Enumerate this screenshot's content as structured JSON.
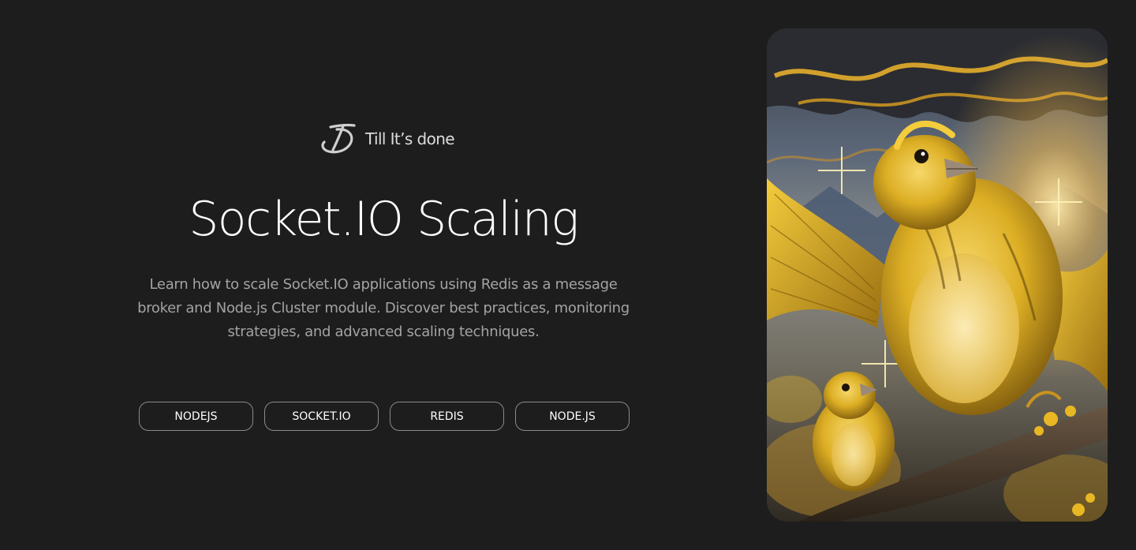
{
  "brand": {
    "logo_text": "Till It’s done",
    "logo_icon": "td-monogram-icon"
  },
  "hero": {
    "title": "Socket.IO Scaling",
    "description": "Learn how to scale Socket.IO applications using Redis as a message broker and Node.js Cluster module. Discover best practices, monitoring strategies, and advanced scaling techniques.",
    "tags": [
      "NODEJS",
      "SOCKET.IO",
      "REDIS",
      "NODE.JS"
    ]
  },
  "illustration": {
    "subject": "golden-finches-on-branch",
    "accent": "#e9b723"
  },
  "colors": {
    "background": "#1d1d1d",
    "title": "#ffffff",
    "description": "#a3a3a3",
    "tag_border": "#8a8a8a"
  }
}
